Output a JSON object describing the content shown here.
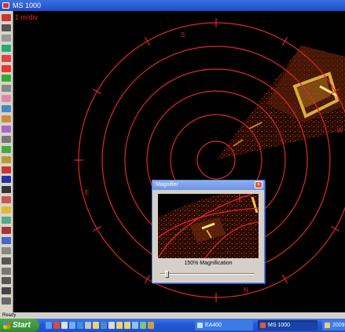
{
  "window": {
    "title": "MS 1000"
  },
  "display": {
    "scale_label": "1 m/div",
    "bearing_labels": {
      "north": "N",
      "south": "S",
      "east": "E",
      "west": "W"
    },
    "ring_color": "#e0282a",
    "echo_color": "#ffd24a"
  },
  "magnifier": {
    "title": "Magnifier",
    "close_label": "×",
    "caption": "150% Magnification",
    "zoom_percent": 150,
    "slider_level": 0.05
  },
  "status": {
    "text": "Ready"
  },
  "taskbar": {
    "start_label": "Start",
    "tasks": [
      {
        "label": "EA400"
      },
      {
        "label": "MS 1000"
      },
      {
        "label": "2009"
      }
    ]
  },
  "toolbar": {
    "icons": [
      "open-icon",
      "save-icon",
      "print-icon",
      "erase-icon",
      "record-icon",
      "stop-icon",
      "play-icon",
      "settings-icon",
      "range-icon",
      "gain-icon",
      "filter-icon",
      "color-icon",
      "pen-icon",
      "link-icon",
      "ruler-icon",
      "marker-icon",
      "book-icon",
      "pointer-icon",
      "grid-icon",
      "palette-icon",
      "zoom-icon",
      "flag-icon",
      "layers-icon",
      "measure-icon",
      "line-icon",
      "text-icon",
      "tool-icon",
      "compass-icon",
      "gear-icon"
    ]
  }
}
